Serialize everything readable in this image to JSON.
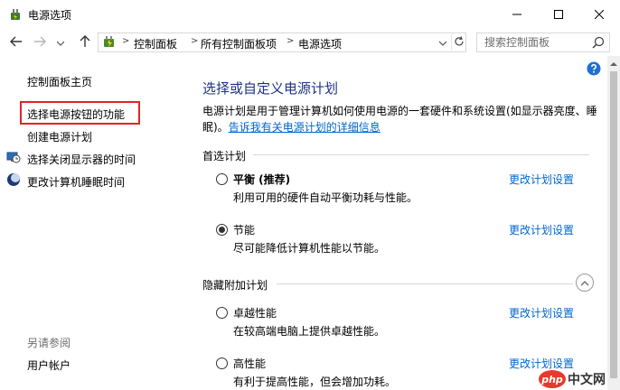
{
  "window": {
    "title": "电源选项",
    "minimize_icon": "minimize-icon",
    "maximize_icon": "maximize-icon",
    "close_icon": "close-icon"
  },
  "navigation": {
    "back_icon": "arrow-left-icon",
    "forward_icon": "arrow-right-icon",
    "recent_icon": "chevron-down-icon",
    "up_icon": "arrow-up-icon",
    "breadcrumb": [
      "控制面板",
      "所有控制面板项",
      "电源选项"
    ],
    "search_placeholder": "搜索控制面板"
  },
  "sidebar": {
    "home": "控制面板主页",
    "items": [
      {
        "label": "选择电源按钮的功能",
        "icon": ""
      },
      {
        "label": "创建电源计划",
        "icon": ""
      },
      {
        "label": "选择关闭显示器的时间",
        "icon": "monitor-clock-icon"
      },
      {
        "label": "更改计算机睡眠时间",
        "icon": "moon-icon"
      }
    ],
    "see_also": "另请参阅",
    "user_accounts": "用户帐户"
  },
  "main": {
    "title": "选择或自定义电源计划",
    "description": "电源计划是用于管理计算机如何使用电源的一套硬件和系统设置(如显示器亮度、睡眠)。",
    "description_link": "告诉我有关电源计划的详细信息",
    "preferred_label": "首选计划",
    "hidden_label": "隐藏附加计划",
    "plans": [
      {
        "name": "平衡 (推荐)",
        "desc": "利用可用的硬件自动平衡功耗与性能。",
        "link": "更改计划设置",
        "selected": false
      },
      {
        "name": "节能",
        "desc": "尽可能降低计算机性能以节能。",
        "link": "更改计划设置",
        "selected": true
      },
      {
        "name": "卓越性能",
        "desc": "在较高端电脑上提供卓越性能。",
        "link": "更改计划设置",
        "selected": false
      },
      {
        "name": "高性能",
        "desc": "有利于提高性能，但会增加功耗。",
        "link": "更改计划设置",
        "selected": false
      }
    ]
  },
  "watermark": {
    "badge": "php",
    "text": "中文网"
  },
  "colors": {
    "title_blue": "#1e3287",
    "link_blue": "#0066cc",
    "highlight_red": "#e8202a"
  }
}
